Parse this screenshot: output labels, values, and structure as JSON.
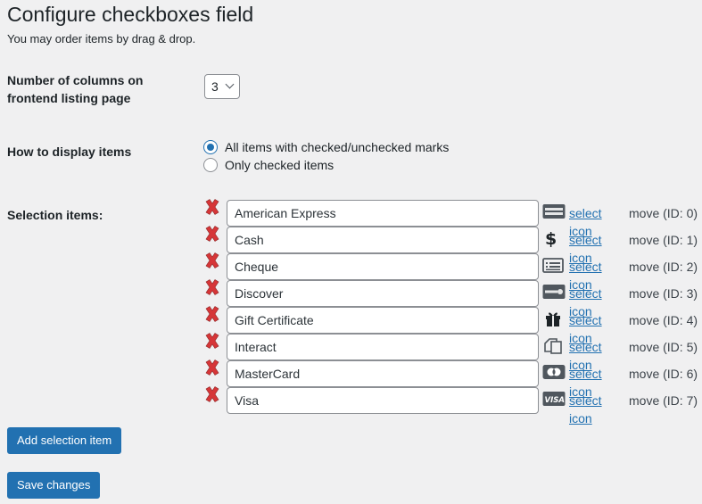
{
  "page": {
    "title": "Configure checkboxes field",
    "subtitle": "You may order items by drag & drop."
  },
  "columns": {
    "label": "Number of columns on frontend listing page",
    "selected": "3"
  },
  "display": {
    "label": "How to display items",
    "options": [
      {
        "label": "All items with checked/unchecked marks",
        "checked": true
      },
      {
        "label": "Only checked items",
        "checked": false
      }
    ]
  },
  "selection": {
    "label": "Selection items:",
    "select_icon_label": "select icon",
    "items": [
      {
        "value": "American Express",
        "icon": "amex-card-icon",
        "move": "move (ID: 0)"
      },
      {
        "value": "Cash",
        "icon": "dollar-icon",
        "move": "move (ID: 1)"
      },
      {
        "value": "Cheque",
        "icon": "cheque-icon",
        "move": "move (ID: 2)"
      },
      {
        "value": "Discover",
        "icon": "discover-card-icon",
        "move": "move (ID: 3)"
      },
      {
        "value": "Gift Certificate",
        "icon": "gift-icon",
        "move": "move (ID: 4)"
      },
      {
        "value": "Interact",
        "icon": "interact-icon",
        "move": "move (ID: 5)"
      },
      {
        "value": "MasterCard",
        "icon": "mastercard-icon",
        "move": "move (ID: 6)"
      },
      {
        "value": "Visa",
        "icon": "visa-card-icon",
        "move": "move (ID: 7)"
      }
    ]
  },
  "buttons": {
    "add": "Add selection item",
    "save": "Save changes"
  },
  "colors": {
    "accent": "#2271b1",
    "delete": "#d63638",
    "background": "#f0f0f1"
  }
}
